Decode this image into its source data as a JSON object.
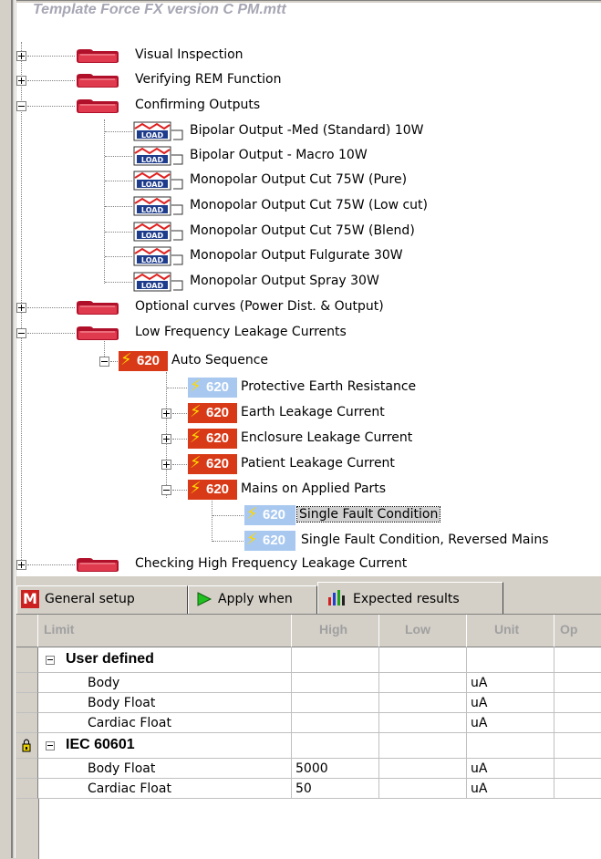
{
  "tree": {
    "title": "Template Force FX version C PM.mtt",
    "nodes": [
      {
        "label": "Visual Inspection"
      },
      {
        "label": "Verifying REM Function"
      },
      {
        "label": "Confirming Outputs"
      },
      {
        "label": "Bipolar Output -Med (Standard) 10W"
      },
      {
        "label": "Bipolar Output - Macro 10W"
      },
      {
        "label": "Monopolar Output Cut 75W (Pure)"
      },
      {
        "label": "Monopolar Output Cut 75W (Low cut)"
      },
      {
        "label": "Monopolar Output Cut 75W (Blend)"
      },
      {
        "label": "Monopolar Output Fulgurate 30W"
      },
      {
        "label": "Monopolar Output Spray 30W"
      },
      {
        "label": "Optional curves (Power Dist. & Output)"
      },
      {
        "label": "Low Frequency Leakage Currents"
      },
      {
        "label": "Auto Sequence"
      },
      {
        "label": "Protective Earth Resistance"
      },
      {
        "label": "Earth Leakage Current"
      },
      {
        "label": "Enclosure Leakage Current"
      },
      {
        "label": "Patient Leakage Current"
      },
      {
        "label": "Mains on Applied Parts"
      },
      {
        "label": "Single Fault Condition"
      },
      {
        "label": "Single Fault Condition, Reversed Mains"
      },
      {
        "label": "Checking High Frequency Leakage Current"
      }
    ],
    "load_icon_text": "LOAD",
    "badge_text": "620"
  },
  "tabs": [
    {
      "label": "General setup"
    },
    {
      "label": "Apply when"
    },
    {
      "label": "Expected results"
    }
  ],
  "grid": {
    "columns": [
      "Limit",
      "High",
      "Low",
      "Unit",
      "Op"
    ],
    "groups": [
      {
        "name": "User defined",
        "rows": [
          {
            "limit": "Body",
            "high": "",
            "low": "",
            "unit": "uA"
          },
          {
            "limit": "Body Float",
            "high": "",
            "low": "",
            "unit": "uA"
          },
          {
            "limit": "Cardiac Float",
            "high": "",
            "low": "",
            "unit": "uA"
          }
        ]
      },
      {
        "name": "IEC 60601",
        "rows": [
          {
            "limit": "Body Float",
            "high": "5000",
            "low": "",
            "unit": "uA"
          },
          {
            "limit": "Cardiac Float",
            "high": "50",
            "low": "",
            "unit": "uA"
          }
        ]
      }
    ]
  },
  "colors": {
    "folder": "#c0203a",
    "badge_red": "#d83a18",
    "badge_blue": "#a8c8f0",
    "lightning": "#ffd800"
  }
}
